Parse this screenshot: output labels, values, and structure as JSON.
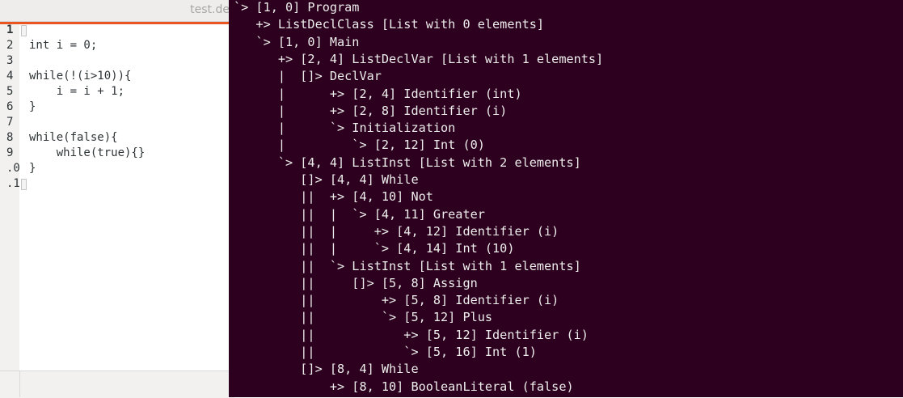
{
  "editor": {
    "title": "test.de",
    "accent_color": "#e95420",
    "lines": [
      {
        "number": "1",
        "code": ""
      },
      {
        "number": "2",
        "code": "int i = 0;"
      },
      {
        "number": "3",
        "code": ""
      },
      {
        "number": "4",
        "code": "while(!(i>10)){"
      },
      {
        "number": "5",
        "code": "    i = i + 1;"
      },
      {
        "number": "6",
        "code": "}"
      },
      {
        "number": "7",
        "code": ""
      },
      {
        "number": "8",
        "code": "while(false){"
      },
      {
        "number": "9",
        "code": "    while(true){}"
      },
      {
        "number": ".0",
        "code": "}"
      },
      {
        "number": ".1",
        "code": ""
      }
    ]
  },
  "terminal": {
    "background": "#2c001e",
    "lines": [
      "`> [1, 0] Program",
      "   +> ListDeclClass [List with 0 elements]",
      "   `> [1, 0] Main",
      "      +> [2, 4] ListDeclVar [List with 1 elements]",
      "      |  []> DeclVar",
      "      |      +> [2, 4] Identifier (int)",
      "      |      +> [2, 8] Identifier (i)",
      "      |      `> Initialization",
      "      |         `> [2, 12] Int (0)",
      "      `> [4, 4] ListInst [List with 2 elements]",
      "         []> [4, 4] While",
      "         ||  +> [4, 10] Not",
      "         ||  |  `> [4, 11] Greater",
      "         ||  |     +> [4, 12] Identifier (i)",
      "         ||  |     `> [4, 14] Int (10)",
      "         ||  `> ListInst [List with 1 elements]",
      "         ||     []> [5, 8] Assign",
      "         ||         +> [5, 8] Identifier (i)",
      "         ||         `> [5, 12] Plus",
      "         ||            +> [5, 12] Identifier (i)",
      "         ||            `> [5, 16] Int (1)",
      "         []> [8, 4] While",
      "             +> [8, 10] BooleanLiteral (false)"
    ]
  }
}
